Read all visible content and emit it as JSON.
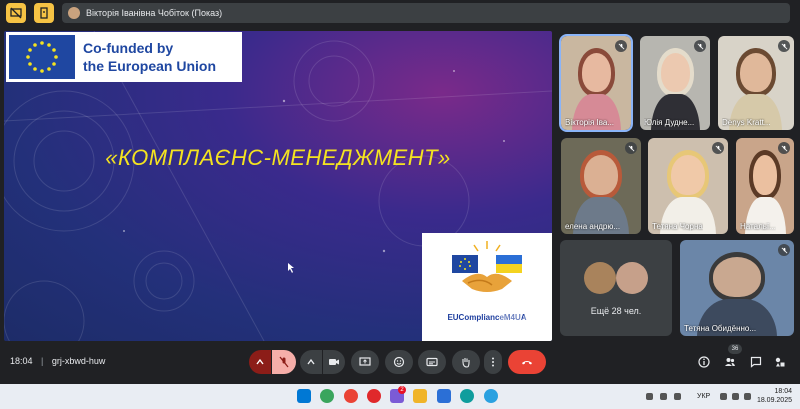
{
  "topbar": {
    "presenter_label": "Вікторія Іванівна Чобіток (Показ)"
  },
  "slide": {
    "eu_line1": "Co-funded by",
    "eu_line2": "the European Union",
    "title": "«КОМПЛАЄНС-МЕНЕДЖМЕНТ»",
    "logo_text": "EUComplianceM4UA"
  },
  "participants": [
    {
      "name": "Вікторія Іва...",
      "bg": "#c9b7a0",
      "face": "#e7b9a0",
      "hair": "#8a4a3a",
      "body": "#d68a96"
    },
    {
      "name": "Юлія Дудне...",
      "bg": "#b7b6b0",
      "face": "#ecc9b0",
      "hair": "#e4dccb",
      "body": "#2f2f35"
    },
    {
      "name": "Denys Kratt...",
      "bg": "#d8d3c8",
      "face": "#e0b89a",
      "hair": "#6b4a32",
      "body": "#d6c9a9"
    },
    {
      "name": "елена андрю...",
      "bg": "#6d6a58",
      "face": "#dbb093",
      "hair": "#b85a3a",
      "body": "#6d7a8a"
    },
    {
      "name": "Тетяна Чорна",
      "bg": "#cdbfae",
      "face": "#f0c9a8",
      "hair": "#e7c777",
      "body": "#f2efe8"
    },
    {
      "name": "Натальї...",
      "bg": "#c9a58a",
      "face": "#ebc0a0",
      "hair": "#5b3a26",
      "body": "#f4f1ec"
    },
    {
      "name": "Тетяна Обидённо...",
      "bg": "#6b86a8",
      "face": "#c9a890",
      "hair": "#3a3a3a",
      "body": "#3d4a5e"
    }
  ],
  "more_participants": {
    "label": "Ещё 28 чел."
  },
  "meeting": {
    "time": "18:04",
    "code": "grj-xbwd-huw",
    "participant_count": "36"
  },
  "taskbar": {
    "language": "УКР",
    "time": "18:04",
    "date": "18.09.2025",
    "mail_badge": "2"
  }
}
